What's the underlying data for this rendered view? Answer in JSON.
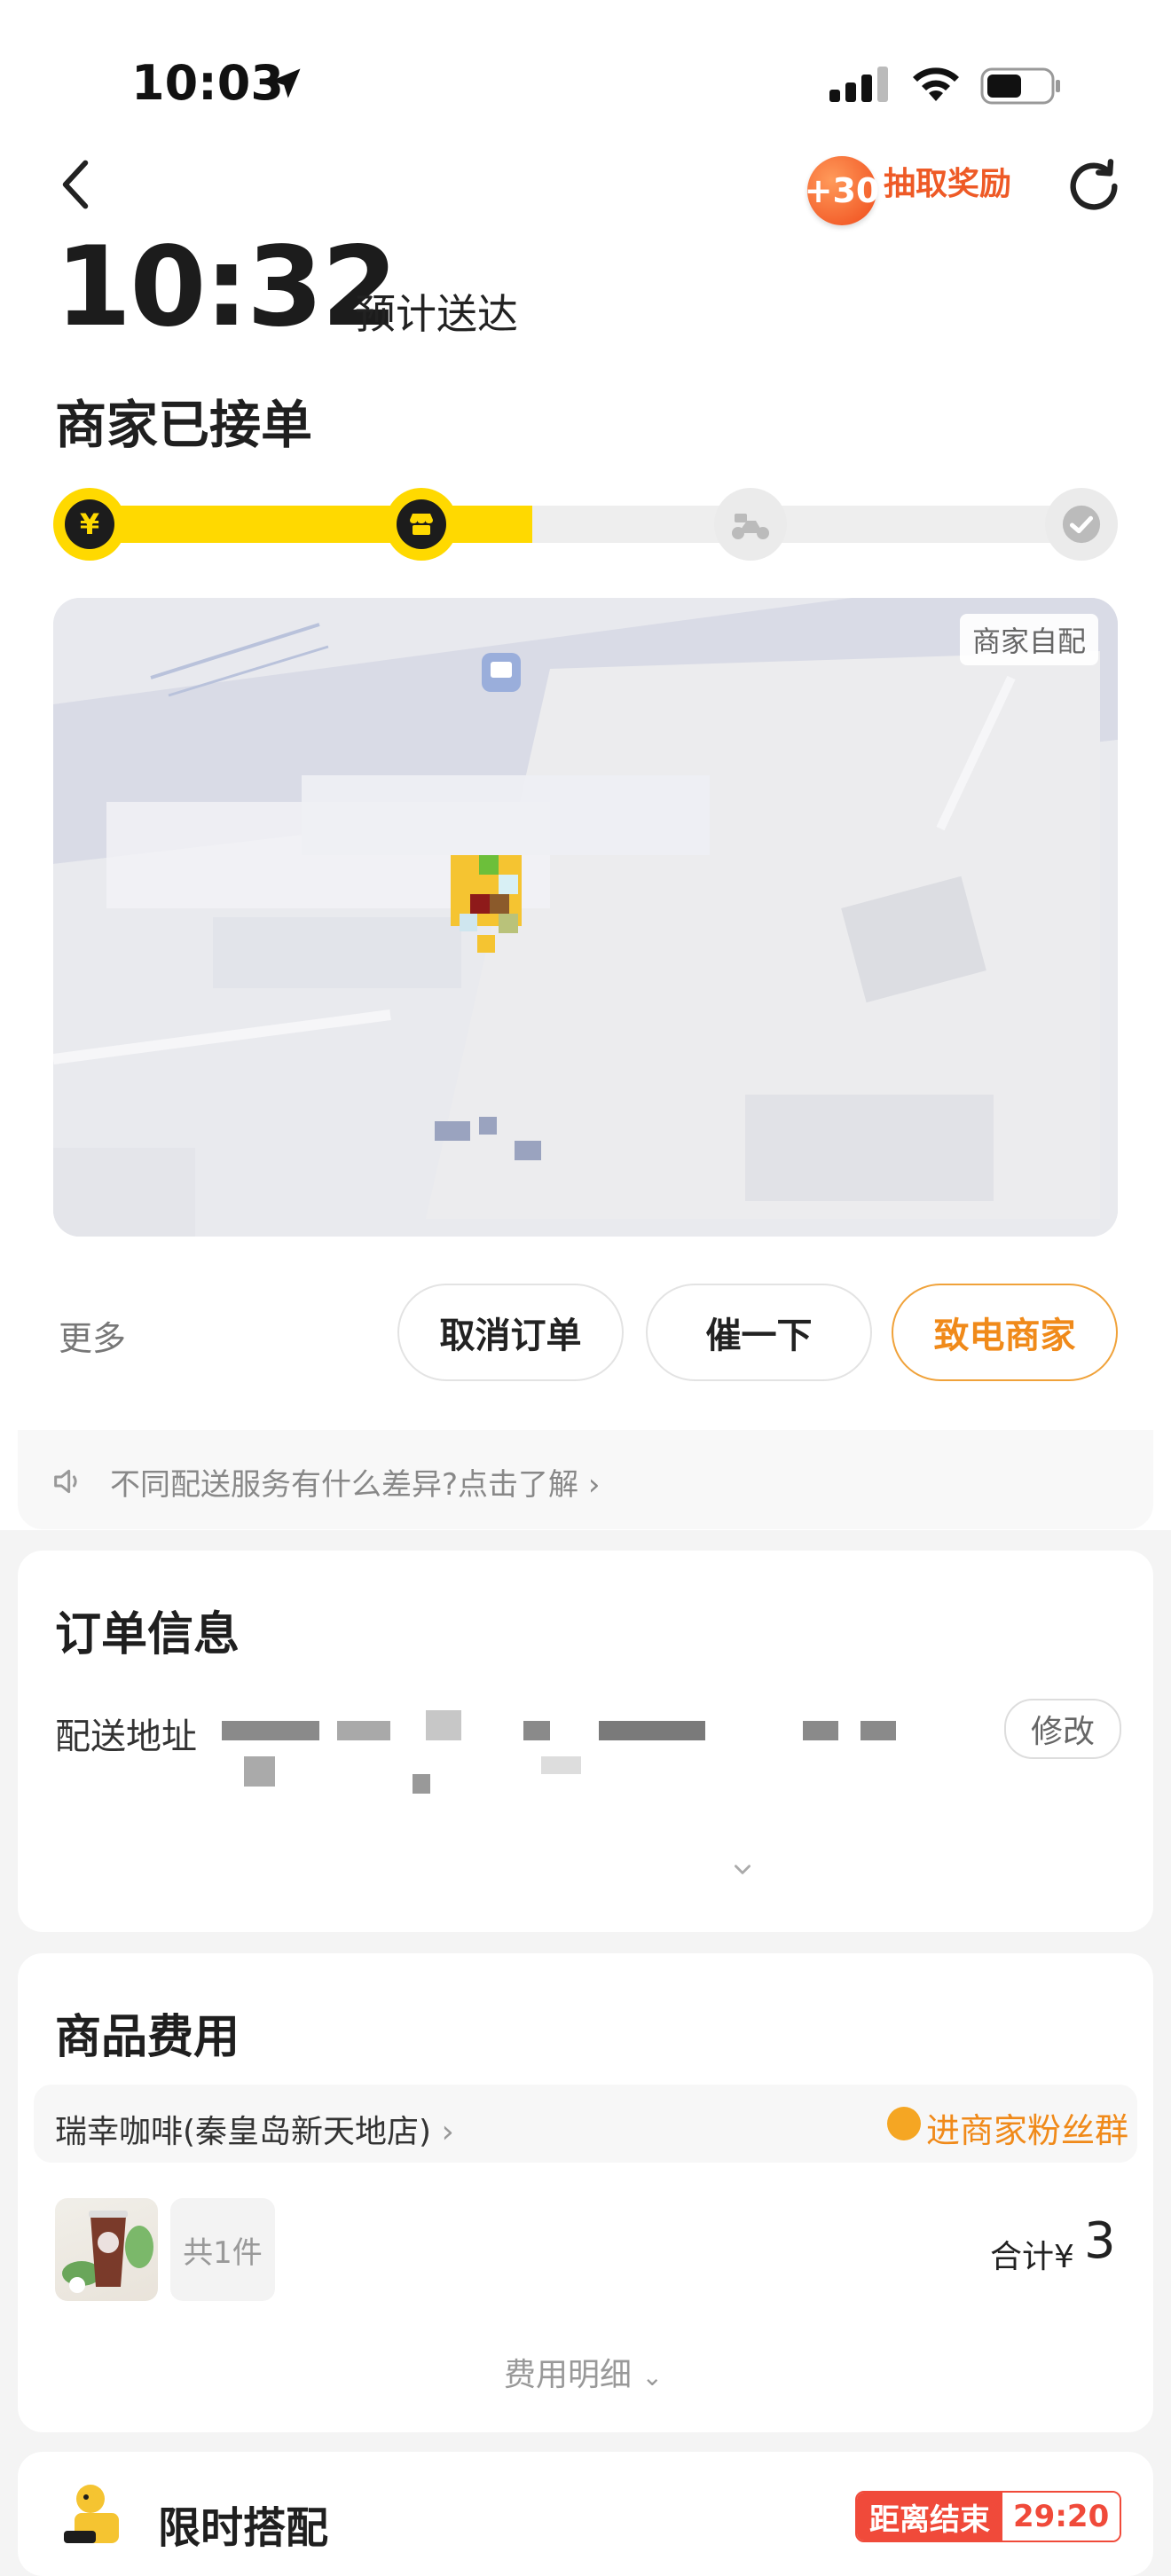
{
  "status_bar": {
    "time": "10:03"
  },
  "header": {
    "reward_badge": "+30",
    "reward_text": "抽取奖励"
  },
  "eta": {
    "time": "10:32",
    "label": "预计送达"
  },
  "order_status": "商家已接单",
  "progress": {
    "completed_steps": 2,
    "total_steps": 4
  },
  "map": {
    "badge": "商家自配"
  },
  "actions": {
    "more": "更多",
    "cancel": "取消订单",
    "urge": "催一下",
    "call": "致电商家"
  },
  "notice": {
    "text": "不同配送服务有什么差异?点击了解"
  },
  "order_info": {
    "title": "订单信息",
    "address_label": "配送地址",
    "modify": "修改"
  },
  "goods": {
    "title": "商品费用",
    "store": "瑞幸咖啡(秦皇岛新天地店)",
    "fan_group": "进商家粉丝群",
    "count": "共1件",
    "total_label": "合计¥",
    "total_value": "3",
    "fee_detail": "费用明细"
  },
  "limited": {
    "title": "限时搭配",
    "countdown_label": "距离结束",
    "countdown_value": "29:20"
  },
  "colors": {
    "accent_yellow": "#ffd900",
    "accent_orange": "#f08a1a",
    "countdown_red": "#f04a3a"
  }
}
